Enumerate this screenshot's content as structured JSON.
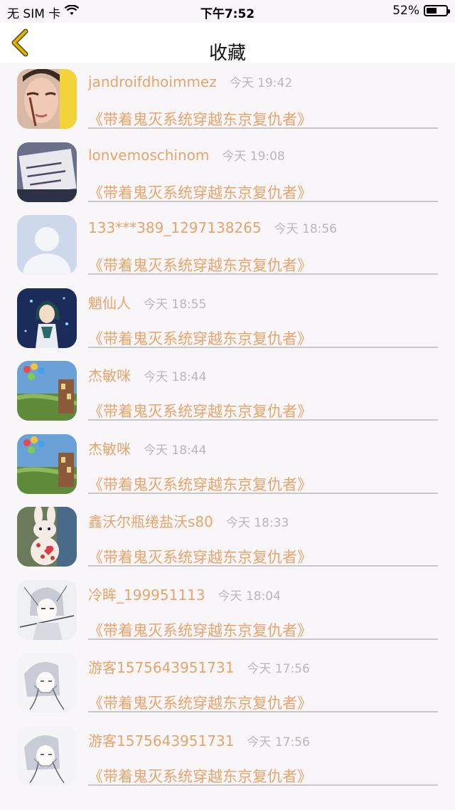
{
  "status_bar": {
    "carrier": "无 SIM 卡",
    "time": "下午7:52",
    "battery_text": "52%",
    "battery_level": 0.52
  },
  "nav": {
    "title": "收藏",
    "back_icon": "chevron-left-icon",
    "accent_color": "#e0b400"
  },
  "colors": {
    "name": "#e8a46a",
    "time": "#b8b8b8",
    "book": "#e8a46a",
    "divider": "#c8c8c8"
  },
  "items": [
    {
      "name": "jandroifdhoimmez",
      "time": "今天 19:42",
      "book": "《带着鬼灭系统穿越东京复仇者》",
      "avatar": "photo-avatar"
    },
    {
      "name": "lonvemoschinom",
      "time": "今天 19:08",
      "book": "《带着鬼灭系统穿越东京复仇者》",
      "avatar": "paper-note-avatar"
    },
    {
      "name": "133***389_1297138265",
      "time": "今天 18:56",
      "book": "《带着鬼灭系统穿越东京复仇者》",
      "avatar": "default-user-avatar"
    },
    {
      "name": "魈仙人",
      "time": "今天 18:55",
      "book": "《带着鬼灭系统穿越东京复仇者》",
      "avatar": "anime-character-avatar"
    },
    {
      "name": "杰敏咪",
      "time": "今天 18:44",
      "book": "《带着鬼灭系统穿越东京复仇者》",
      "avatar": "balloon-house-avatar"
    },
    {
      "name": "杰敏咪",
      "time": "今天 18:44",
      "book": "《带着鬼灭系统穿越东京复仇者》",
      "avatar": "balloon-house-avatar"
    },
    {
      "name": "鑫沃尔瓶绻盐沃s80",
      "time": "今天 18:33",
      "book": "《带着鬼灭系统穿越东京复仇者》",
      "avatar": "bunny-doll-avatar"
    },
    {
      "name": "冷眸_199951113",
      "time": "今天 18:04",
      "book": "《带着鬼灭系统穿越东京复仇者》",
      "avatar": "sketch-character-avatar"
    },
    {
      "name": "游客1575643951731",
      "time": "今天 17:56",
      "book": "《带着鬼灭系统穿越东京复仇者》",
      "avatar": "sketch-girl-avatar"
    },
    {
      "name": "游客1575643951731",
      "time": "今天 17:56",
      "book": "《带着鬼灭系统穿越东京复仇者》",
      "avatar": "sketch-girl-avatar"
    }
  ]
}
